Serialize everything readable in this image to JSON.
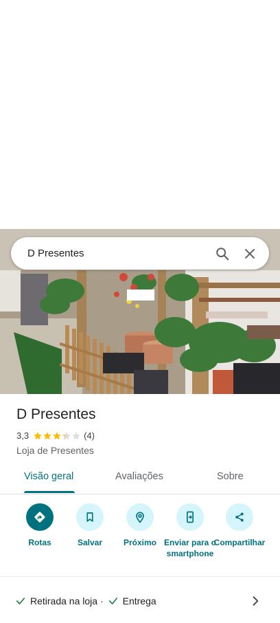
{
  "search": {
    "query": "D Presentes"
  },
  "place": {
    "title": "D Presentes",
    "rating": "3,3",
    "rating_value": 3.3,
    "review_count": "(4)",
    "category": "Loja de Presentes"
  },
  "tabs": [
    {
      "label": "Visão geral",
      "active": true
    },
    {
      "label": "Avaliações",
      "active": false
    },
    {
      "label": "Sobre",
      "active": false
    }
  ],
  "actions": [
    {
      "label": "Rotas",
      "icon": "directions-icon"
    },
    {
      "label": "Salvar",
      "icon": "bookmark-icon"
    },
    {
      "label": "Próximo",
      "icon": "nearby-icon"
    },
    {
      "label": "Enviar para o smartphone",
      "icon": "send-to-phone-icon"
    },
    {
      "label": "Compartilhar",
      "icon": "share-icon"
    }
  ],
  "services": {
    "item1": "Retirada na loja ·",
    "item2": "Entrega"
  },
  "colors": {
    "accent": "#00727f",
    "accent_light": "#d3f5fb",
    "star": "#fbbc04",
    "check": "#188038"
  }
}
